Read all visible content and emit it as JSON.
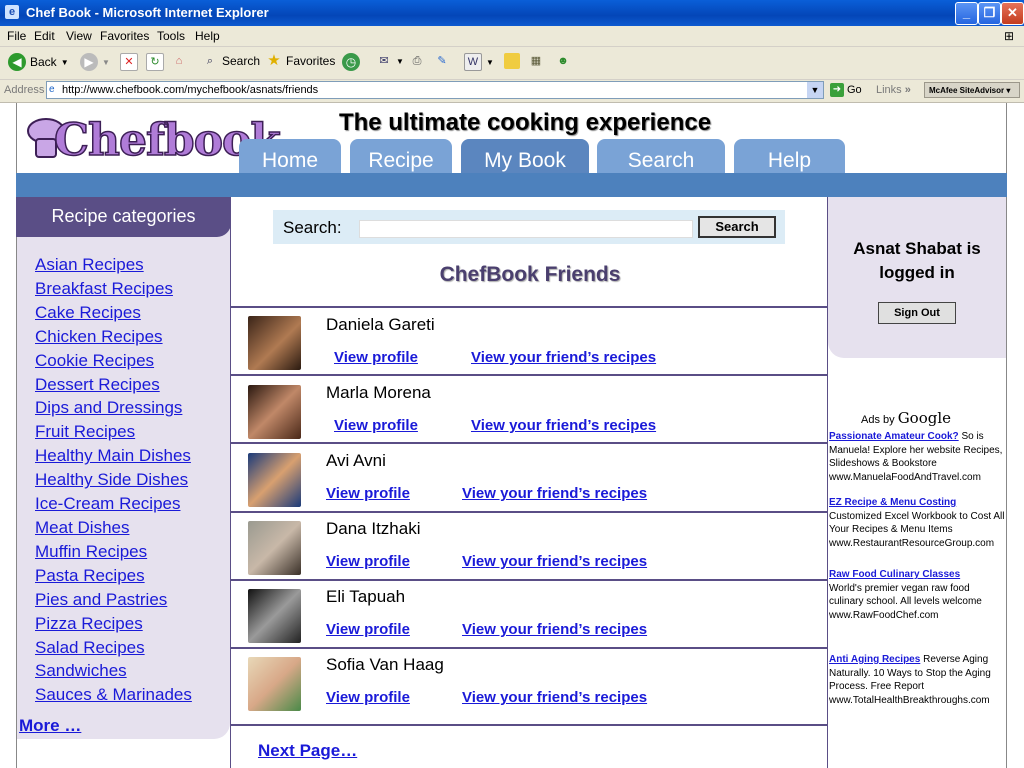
{
  "window": {
    "title": "Chef Book - Microsoft Internet Explorer"
  },
  "menu": [
    "File",
    "Edit",
    "View",
    "Favorites",
    "Tools",
    "Help"
  ],
  "toolbar": {
    "back": "Back",
    "search": "Search",
    "favorites": "Favorites"
  },
  "address": {
    "label": "Address",
    "url": "http://www.chefbook.com/mychefbook/asnats/friends",
    "go": "Go",
    "links": "Links",
    "mcafee": "McAfee SiteAdvisor"
  },
  "site": {
    "logo": "Chefbook",
    "tagline": "The ultimate cooking experience",
    "tabs": [
      "Home",
      "Recipe",
      "My  Book",
      "Search",
      "Help"
    ]
  },
  "categories": {
    "header": "Recipe categories",
    "items": [
      "Asian Recipes",
      "Breakfast Recipes",
      "Cake Recipes",
      "Chicken Recipes",
      "Cookie Recipes",
      "Dessert Recipes",
      "Dips and Dressings",
      "Fruit Recipes",
      "Healthy Main Dishes",
      "Healthy Side Dishes",
      "Ice-Cream Recipes",
      "Meat Dishes",
      "Muffin Recipes",
      "Pasta Recipes",
      "Pies and Pastries",
      "Pizza Recipes",
      "Salad Recipes",
      "Sandwiches",
      "Sauces & Marinades"
    ],
    "more": "More …"
  },
  "search": {
    "label": "Search:",
    "button": "Search"
  },
  "friends": {
    "title": "ChefBook Friends",
    "profile_label": "View profile",
    "recipes_label": "View your friend’s recipes",
    "list": [
      {
        "name": "Daniela Gareti"
      },
      {
        "name": "Marla Morena"
      },
      {
        "name": "Avi Avni"
      },
      {
        "name": "Dana Itzhaki"
      },
      {
        "name": "Eli Tapuah"
      },
      {
        "name": "Sofia Van Haag"
      }
    ],
    "next": "Next Page…"
  },
  "user": {
    "status": "Asnat Shabat is logged in",
    "signout": "Sign Out"
  },
  "ads": {
    "ads_by": "Ads by",
    "google": "Google",
    "items": [
      {
        "title": "Passionate Amateur Cook?",
        "body": "So is Manuela! Explore her website Recipes, Slideshows & Bookstore",
        "url": "www.ManuelaFoodAndTravel.com"
      },
      {
        "title": "EZ Recipe & Menu Costing",
        "body": "Customized Excel Workbook to Cost All Your Recipes & Menu Items",
        "url": "www.RestaurantResourceGroup.com"
      },
      {
        "title": "Raw Food Culinary Classes",
        "body": "World's premier vegan raw food culinary school. All levels welcome",
        "url": "www.RawFoodChef.com"
      },
      {
        "title": "Anti Aging Recipes",
        "body": "Reverse Aging Naturally. 10 Ways to Stop the Aging Process. Free Report",
        "url": "www.TotalHealthBreakthroughs.com"
      }
    ]
  }
}
